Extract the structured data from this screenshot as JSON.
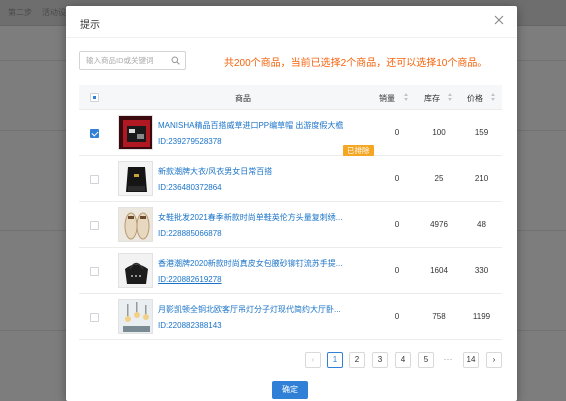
{
  "background": {
    "tabs": [
      "第二步",
      "活动设置"
    ]
  },
  "dialog": {
    "title": "提示",
    "search_placeholder": "输入商品ID或关键词",
    "notice": "共200个商品，当前已选择2个商品，还可以选择10个商品。",
    "columns": {
      "product": "商品",
      "sales": "销量",
      "stock": "库存",
      "price": "价格"
    },
    "rows": [
      {
        "name": "MANISHA精品百搭威草进口PP编草帽 出游度假大檐...",
        "id": "ID:239279528378",
        "sales": "0",
        "stock": "100",
        "price": "159",
        "checked": true,
        "badge": "已排除"
      },
      {
        "name": "新款潮牌大衣/风衣男女日常百搭",
        "id": "ID:236480372864",
        "sales": "0",
        "stock": "25",
        "price": "210",
        "checked": false
      },
      {
        "name": "女鞋批发2021春季新款时尚单鞋英伦方头量复刺绣...",
        "id": "ID:228885066878",
        "sales": "0",
        "stock": "4976",
        "price": "48",
        "checked": false
      },
      {
        "name": "香港潮牌2020新款时尚真皮女包腋砂铆钉流苏手提...",
        "id": "ID:220882619278",
        "sales": "0",
        "stock": "1604",
        "price": "330",
        "checked": false
      },
      {
        "name": "月影凯顿全铜北欧客厅吊灯分子灯现代简约大厅卧...",
        "id": "ID:220882388143",
        "sales": "0",
        "stock": "758",
        "price": "1199",
        "checked": false
      }
    ],
    "pagination": {
      "pages": [
        "1",
        "2",
        "3",
        "4",
        "5"
      ],
      "ellipsis": "···",
      "last": "14",
      "current": "1"
    },
    "confirm_label": "确定"
  },
  "colors": {
    "accent": "#2f80d6",
    "notice": "#f5620a",
    "badge": "#f5a623"
  }
}
